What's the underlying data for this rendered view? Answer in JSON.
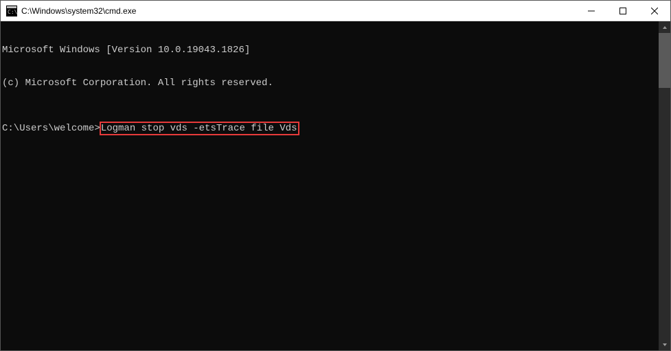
{
  "titlebar": {
    "title": "C:\\Windows\\system32\\cmd.exe"
  },
  "terminal": {
    "line1": "Microsoft Windows [Version 10.0.19043.1826]",
    "line2": "(c) Microsoft Corporation. All rights reserved.",
    "prompt": "C:\\Users\\welcome>",
    "command": "Logman stop vds -etsTrace file Vds"
  },
  "highlight": {
    "color": "#e73a3a"
  }
}
